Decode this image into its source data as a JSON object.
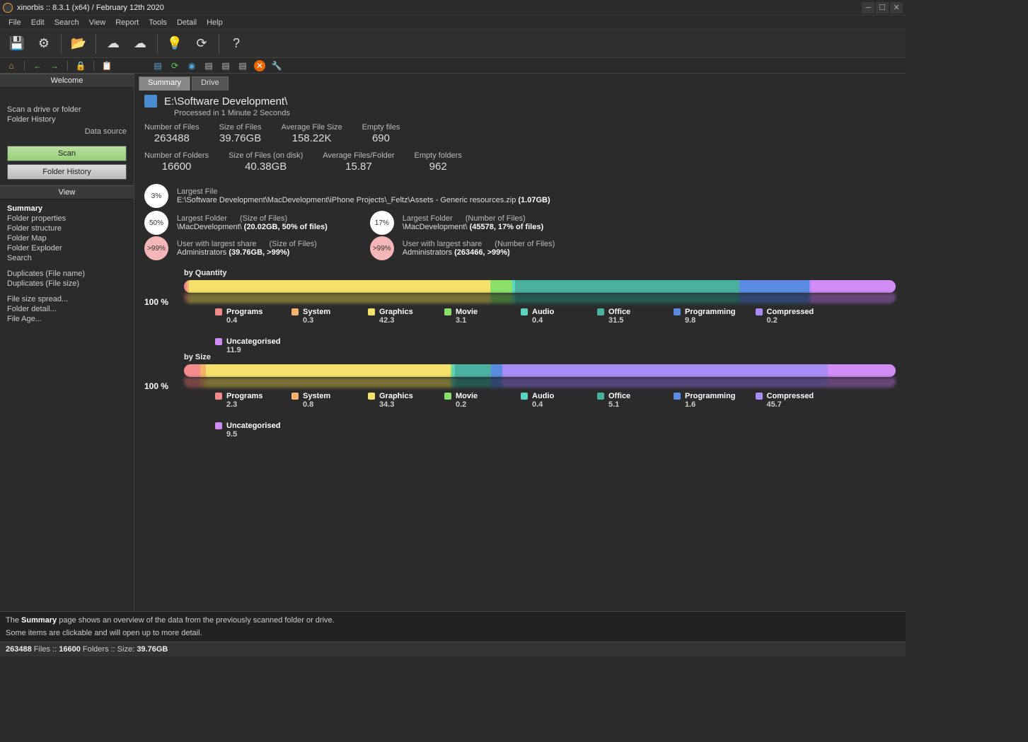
{
  "window": {
    "title": "xinorbis :: 8.3.1 (x64) / February 12th 2020"
  },
  "menu": [
    "File",
    "Edit",
    "Search",
    "View",
    "Report",
    "Tools",
    "Detail",
    "Help"
  ],
  "sidebar": {
    "welcome_header": "Welcome",
    "scan_link": "Scan a drive or folder",
    "history_link": "Folder History",
    "datasource": "Data source",
    "scan_btn": "Scan",
    "history_btn": "Folder History",
    "view_header": "View",
    "nav": [
      {
        "t": "Summary",
        "bold": true
      },
      {
        "t": "Folder properties"
      },
      {
        "t": "Folder structure"
      },
      {
        "t": "Folder Map"
      },
      {
        "t": "Folder Exploder"
      },
      {
        "t": "Search"
      },
      {
        "gap": true
      },
      {
        "t": "Duplicates (File name)"
      },
      {
        "t": "Duplicates (File size)"
      },
      {
        "gap": true
      },
      {
        "t": "File size spread..."
      },
      {
        "t": "Folder detail..."
      },
      {
        "t": "File Age..."
      }
    ]
  },
  "tabs": {
    "summary": "Summary",
    "drive": "Drive"
  },
  "path": "E:\\Software Development\\",
  "processed": "Processed in 1 Minute 2 Seconds",
  "stats": [
    {
      "l": "Number of Files",
      "v": "263488"
    },
    {
      "l": "Size of Files",
      "v": "39.76GB"
    },
    {
      "l": "Average File Size",
      "v": "158.22K"
    },
    {
      "l": "Empty files",
      "v": "690"
    },
    {
      "l": "Number of Folders",
      "v": "16600"
    },
    {
      "l": "Size of Files (on disk)",
      "v": "40.38GB"
    },
    {
      "l": "Average Files/Folder",
      "v": "15.87"
    },
    {
      "l": "Empty folders",
      "v": "962"
    }
  ],
  "largest_file": {
    "label": "Largest File",
    "pct": "3%",
    "path": "E:\\Software Development\\MacDevelopment\\iPhone Projects\\_Feltz\\Assets - Generic resources.zip",
    "size": "(1.07GB)"
  },
  "largest_folder_size": {
    "label": "Largest Folder",
    "sub": "(Size of Files)",
    "pct": "50%",
    "path": "\\MacDevelopment\\",
    "val": "(20.02GB, 50% of files)"
  },
  "largest_folder_num": {
    "label": "Largest Folder",
    "sub": "(Number of Files)",
    "pct": "17%",
    "path": "\\MacDevelopment\\",
    "val": "(45578, 17% of files)"
  },
  "user_size": {
    "label": "User with largest share",
    "sub": "(Size of Files)",
    "pct": ">99%",
    "name": "Administrators",
    "val": "(39.76GB, >99%)"
  },
  "user_num": {
    "label": "User with largest share",
    "sub": "(Number of Files)",
    "pct": ">99%",
    "name": "Administrators",
    "val": "(263466, >99%)"
  },
  "chart_data": {
    "type": "bar",
    "title_qty": "by Quantity",
    "title_size": "by Size",
    "pct_label": "100 %",
    "categories": [
      "Programs",
      "System",
      "Graphics",
      "Movie",
      "Audio",
      "Office",
      "Programming",
      "Compressed",
      "Uncategorised"
    ],
    "colors": [
      "#f48b8b",
      "#f4b26b",
      "#f4e06b",
      "#8be06b",
      "#5bd4c0",
      "#4ab0a0",
      "#5b8be0",
      "#a88bf4",
      "#d08bf4"
    ],
    "by_quantity": [
      0.4,
      0.3,
      42.3,
      3.1,
      0.4,
      31.5,
      9.8,
      0.2,
      11.9
    ],
    "by_size": [
      2.3,
      0.8,
      34.3,
      0.2,
      0.4,
      5.1,
      1.6,
      45.7,
      9.5
    ]
  },
  "footer": {
    "l1a": "The ",
    "l1b": "Summary",
    "l1c": " page shows an overview of the data from the previously scanned folder or drive.",
    "l2": "Some items are clickable and will open up to more detail."
  },
  "status": {
    "files": "263488",
    "files_l": " Files  ::  ",
    "folders": "16600",
    "folders_l": " Folders  ::  Size: ",
    "size": "39.76GB"
  }
}
